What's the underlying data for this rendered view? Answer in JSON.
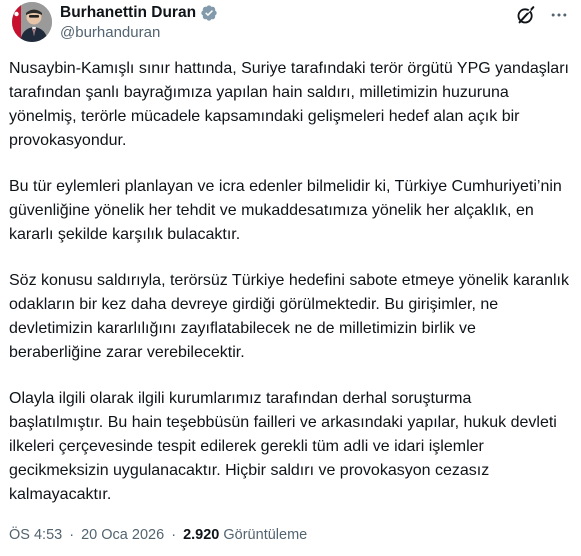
{
  "author": {
    "display_name": "Burhanettin Duran",
    "handle": "@burhanduran",
    "verified_badge_color": "#829aab"
  },
  "tweet": {
    "paragraphs": [
      "Nusaybin-Kamışlı sınır hattında, Suriye tarafındaki terör örgütü YPG yandaşları tarafından şanlı bayrağımıza yapılan hain saldırı, milletimizin huzuruna yönelmiş, terörle mücadele kapsamındaki gelişmeleri hedef alan açık bir provokasyondur.",
      "Bu tür eylemleri planlayan ve icra edenler bilmelidir ki, Türkiye Cumhuriyeti’nin güvenliğine yönelik her tehdit ve mukaddesatımıza yönelik her alçaklık, en kararlı şekilde karşılık bulacaktır.",
      "Söz konusu saldırıyla, terörsüz Türkiye hedefini sabote etmeye yönelik karanlık odakların bir kez daha devreye girdiği görülmektedir. Bu girişimler, ne devletimizin kararlılığını zayıflatabilecek ne de milletimizin birlik ve beraberliğine zarar verebilecektir.",
      "Olayla ilgili olarak ilgili kurumlarımız tarafından derhal soruşturma başlatılmıştır. Bu hain teşebbüsün failleri ve arkasındaki yapılar, hukuk devleti ilkeleri çerçevesinde tespit edilerek gerekli tüm adli ve idari işlemler gecikmeksizin uygulanacaktır. Hiçbir saldırı ve provokasyon cezasız kalmayacaktır."
    ],
    "time": "ÖS 4:53",
    "date": "20 Oca 2026",
    "views_count": "2.920",
    "views_label": "Görüntüleme",
    "separator": "·"
  },
  "icons": {
    "verified": "verified-badge-icon",
    "grok": "grok-icon",
    "more": "more-icon"
  }
}
